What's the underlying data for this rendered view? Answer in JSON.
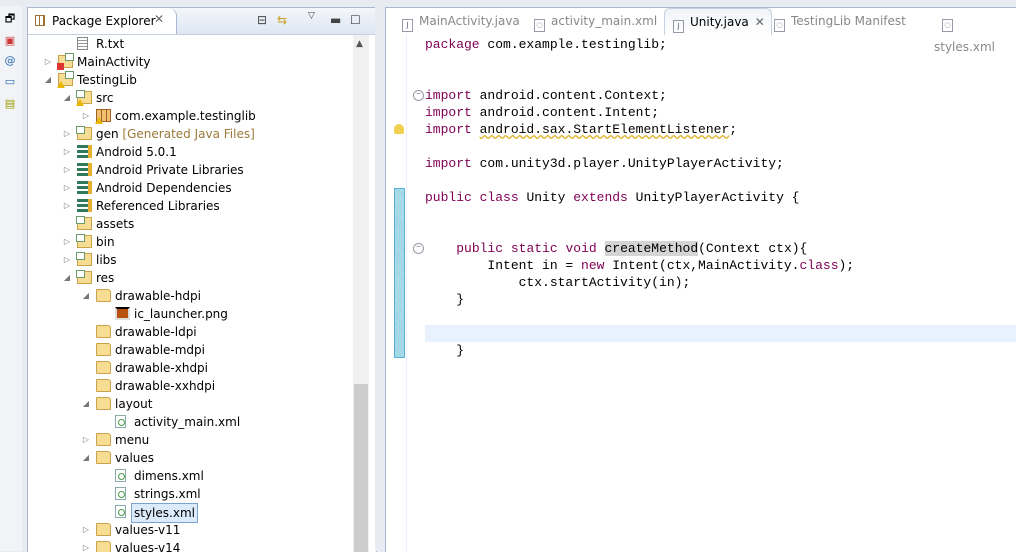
{
  "left_toolbar": {
    "icons": [
      "restore-icon",
      "javadoc-icon",
      "declaration-icon",
      "console-icon",
      "android-device-icon"
    ]
  },
  "package_explorer": {
    "title": "Package Explorer",
    "tree": [
      {
        "label": "R.txt",
        "level": 1,
        "arrow": "none",
        "icon": "txt"
      },
      {
        "label": "MainActivity",
        "level": 0,
        "arrow": "collapsed",
        "icon": "project",
        "badge": "error"
      },
      {
        "label": "TestingLib",
        "level": 0,
        "arrow": "expanded",
        "icon": "project",
        "badge": "warning"
      },
      {
        "label": "src",
        "level": 1,
        "arrow": "expanded",
        "icon": "srcfolder",
        "badge": "warning"
      },
      {
        "label": "com.example.testinglib",
        "level": 2,
        "arrow": "collapsed",
        "icon": "pkg",
        "badge": "warning"
      },
      {
        "label": "gen",
        "level": 1,
        "arrow": "collapsed",
        "icon": "srcfolder",
        "decoration": "[Generated Java Files]"
      },
      {
        "label": "Android 5.0.1",
        "level": 1,
        "arrow": "collapsed",
        "icon": "lib"
      },
      {
        "label": "Android Private Libraries",
        "level": 1,
        "arrow": "collapsed",
        "icon": "lib"
      },
      {
        "label": "Android Dependencies",
        "level": 1,
        "arrow": "collapsed",
        "icon": "lib"
      },
      {
        "label": "Referenced Libraries",
        "level": 1,
        "arrow": "collapsed",
        "icon": "lib"
      },
      {
        "label": "assets",
        "level": 1,
        "arrow": "none",
        "icon": "srcfolder"
      },
      {
        "label": "bin",
        "level": 1,
        "arrow": "collapsed",
        "icon": "srcfolder"
      },
      {
        "label": "libs",
        "level": 1,
        "arrow": "collapsed",
        "icon": "srcfolder"
      },
      {
        "label": "res",
        "level": 1,
        "arrow": "expanded",
        "icon": "srcfolder"
      },
      {
        "label": "drawable-hdpi",
        "level": 2,
        "arrow": "expanded",
        "icon": "folder"
      },
      {
        "label": "ic_launcher.png",
        "level": 3,
        "arrow": "none",
        "icon": "png"
      },
      {
        "label": "drawable-ldpi",
        "level": 2,
        "arrow": "none",
        "icon": "folder"
      },
      {
        "label": "drawable-mdpi",
        "level": 2,
        "arrow": "none",
        "icon": "folder"
      },
      {
        "label": "drawable-xhdpi",
        "level": 2,
        "arrow": "none",
        "icon": "folder"
      },
      {
        "label": "drawable-xxhdpi",
        "level": 2,
        "arrow": "none",
        "icon": "folder"
      },
      {
        "label": "layout",
        "level": 2,
        "arrow": "expanded",
        "icon": "folder"
      },
      {
        "label": "activity_main.xml",
        "level": 3,
        "arrow": "none",
        "icon": "xml"
      },
      {
        "label": "menu",
        "level": 2,
        "arrow": "collapsed",
        "icon": "folder"
      },
      {
        "label": "values",
        "level": 2,
        "arrow": "expanded",
        "icon": "folder"
      },
      {
        "label": "dimens.xml",
        "level": 3,
        "arrow": "none",
        "icon": "xml"
      },
      {
        "label": "strings.xml",
        "level": 3,
        "arrow": "none",
        "icon": "xml"
      },
      {
        "label": "styles.xml",
        "level": 3,
        "arrow": "none",
        "icon": "xml",
        "selected": true
      },
      {
        "label": "values-v11",
        "level": 2,
        "arrow": "collapsed",
        "icon": "folder"
      },
      {
        "label": "values-v14",
        "level": 2,
        "arrow": "collapsed",
        "icon": "folder"
      }
    ]
  },
  "editor": {
    "tabs": [
      {
        "label": "MainActivity.java",
        "icon": "java",
        "active": false
      },
      {
        "label": "activity_main.xml",
        "icon": "xml",
        "active": false
      },
      {
        "label": "Unity.java",
        "icon": "java",
        "active": true
      },
      {
        "label": "TestingLib Manifest",
        "icon": "xml",
        "active": false
      },
      {
        "label": "styles.xml",
        "icon": "xml",
        "active": false
      }
    ],
    "lines": [
      [
        [
          "package",
          "kw"
        ],
        [
          " com.example.testinglib;",
          ""
        ]
      ],
      [],
      [],
      [
        [
          "import",
          "kw"
        ],
        [
          " android.content.Context;",
          ""
        ]
      ],
      [
        [
          "import",
          "kw"
        ],
        [
          " android.content.Intent;",
          ""
        ]
      ],
      [
        [
          "import",
          "kw"
        ],
        [
          " ",
          ""
        ],
        [
          "android.sax.StartElementListener",
          "warn"
        ],
        [
          ";",
          ""
        ]
      ],
      [],
      [
        [
          "import",
          "kw"
        ],
        [
          " com.unity3d.player.UnityPlayerActivity;",
          ""
        ]
      ],
      [],
      [
        [
          "public",
          "kw"
        ],
        [
          " ",
          ""
        ],
        [
          "class",
          "kw"
        ],
        [
          " Unity ",
          ""
        ],
        [
          "extends",
          "kw"
        ],
        [
          " UnityPlayerActivity {",
          ""
        ]
      ],
      [],
      [],
      [
        [
          "    ",
          ""
        ],
        [
          "public",
          "kw"
        ],
        [
          " ",
          ""
        ],
        [
          "static",
          "kw"
        ],
        [
          " ",
          ""
        ],
        [
          "void",
          "kw"
        ],
        [
          " ",
          ""
        ],
        [
          "createMethod",
          "hl"
        ],
        [
          "(Context ctx){",
          ""
        ]
      ],
      [
        [
          "        Intent in = ",
          ""
        ],
        [
          "new",
          "kw"
        ],
        [
          " Intent(ctx,MainActivity.",
          ""
        ],
        [
          "class",
          "kw"
        ],
        [
          ");",
          ""
        ]
      ],
      [
        [
          "            ctx.startActivity(in);",
          ""
        ]
      ],
      [
        [
          "    }",
          ""
        ]
      ],
      [],
      [],
      [
        [
          "    }",
          ""
        ]
      ]
    ],
    "current_line": 17,
    "fold_lines": [
      3,
      12
    ],
    "warning_line": 5
  }
}
